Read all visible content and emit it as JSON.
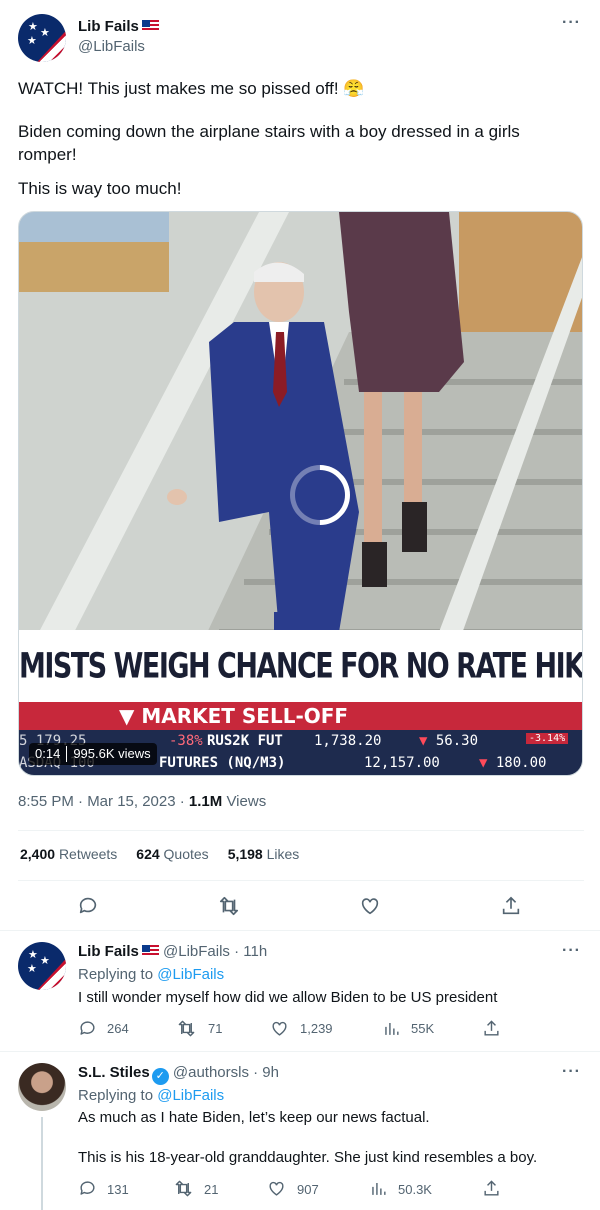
{
  "main_tweet": {
    "author_name": "Lib Fails",
    "author_handle": "@LibFails",
    "text_line1": "WATCH! This just makes me so pissed off! 😤",
    "text_line2": "Biden coming down the airplane stairs with a boy dressed in a girls romper!",
    "text_line3": "This is way too much!",
    "video": {
      "duration": "0:14",
      "views": "995.6K views",
      "chyron_headline": "MISTS WEIGH CHANCE FOR NO RATE HIKE NEXT WEEK",
      "chyron_sub": "MARKET SELL-OFF",
      "ticker1_label": "RUS2K FUT",
      "ticker1_value": "1,738.20",
      "ticker1_change": "56.30",
      "ticker1_pct": "-3.14%",
      "ticker2_label": "FUTURES (NQ/M3)",
      "ticker2_value": "12,157.00",
      "ticker2_change": "180.00",
      "ticker2_partial": "ASDAQ 100",
      "ticker_left_pct": "-38%",
      "ticker_left_partial": "5 179.25"
    },
    "time": "8:55 PM · Mar 15, 2023 · ",
    "views_count": "1.1M",
    "views_label": " Views",
    "retweets_count": "2,400",
    "retweets_label": "Retweets",
    "quotes_count": "624",
    "quotes_label": "Quotes",
    "likes_count": "5,198",
    "likes_label": "Likes"
  },
  "replies": [
    {
      "author_name": "Lib Fails",
      "author_handle": "@LibFails · 11h",
      "replying_to_label": "Replying to ",
      "replying_to_handle": "@LibFails",
      "text": "I still wonder myself how did we allow Biden to be US president",
      "replies": "264",
      "retweets": "71",
      "likes": "1,239",
      "views": "55K"
    },
    {
      "author_name": "S.L. Stiles",
      "author_handle": "@authorsls · 9h",
      "replying_to_label": "Replying to ",
      "replying_to_handle": "@LibFails",
      "text_line1": "As much as I hate Biden, let’s keep our news factual.",
      "text_line2": "This is his 18-year-old granddaughter. She just kind resembles a boy.",
      "replies": "131",
      "retweets": "21",
      "likes": "907",
      "views": "50.3K"
    }
  ],
  "more_label": "···",
  "colors": {
    "accent": "#1d9bf0",
    "muted": "#536471",
    "divider": "#eff3f4"
  }
}
